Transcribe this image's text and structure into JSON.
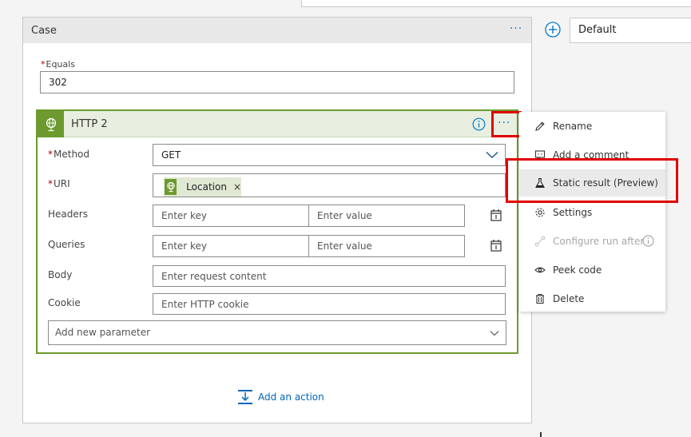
{
  "case": {
    "title": "Case",
    "more": "···",
    "equals": {
      "required_mark": "*",
      "label": "Equals",
      "value": "302"
    }
  },
  "http": {
    "title": "HTTP 2",
    "more": "···",
    "method": {
      "required_mark": "*",
      "label": "Method",
      "value": "GET"
    },
    "uri": {
      "required_mark": "*",
      "label": "URI",
      "token": "Location",
      "token_remove": "×"
    },
    "headers": {
      "label": "Headers",
      "key_placeholder": "Enter key",
      "value_placeholder": "Enter value"
    },
    "queries": {
      "label": "Queries",
      "key_placeholder": "Enter key",
      "value_placeholder": "Enter value"
    },
    "body": {
      "label": "Body",
      "placeholder": "Enter request content"
    },
    "cookie": {
      "label": "Cookie",
      "placeholder": "Enter HTTP cookie"
    },
    "add_parameter": "Add new parameter"
  },
  "add_action": "Add an action",
  "default_field": "Default",
  "menu": {
    "items": [
      {
        "label": "Rename",
        "icon": "pencil-icon"
      },
      {
        "label": "Add a comment",
        "icon": "comment-icon"
      },
      {
        "label": "Static result (Preview)",
        "icon": "flask-icon"
      },
      {
        "label": "Settings",
        "icon": "gear-icon"
      },
      {
        "label": "Configure run after",
        "icon": "run-after-icon"
      },
      {
        "label": "Peek code",
        "icon": "eye-icon"
      },
      {
        "label": "Delete",
        "icon": "trash-icon"
      }
    ]
  },
  "colors": {
    "accent": "#0078d4",
    "http_green": "#6d9a2e",
    "highlight_red": "#e00000"
  }
}
